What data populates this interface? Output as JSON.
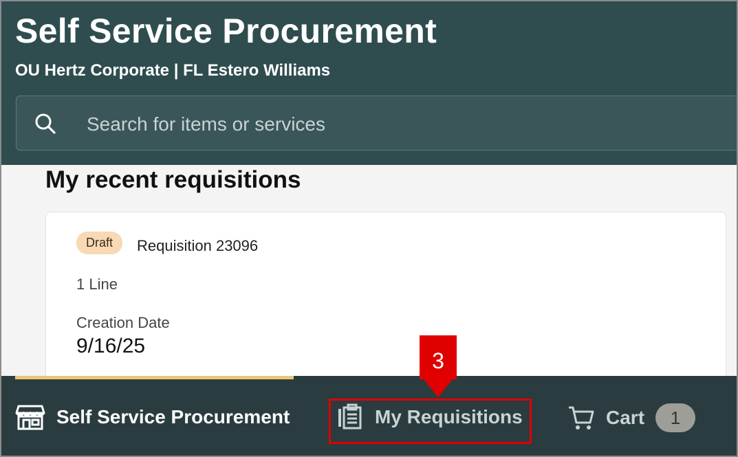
{
  "header": {
    "title": "Self Service Procurement",
    "subtitle": "OU Hertz Corporate | FL Estero Williams"
  },
  "search": {
    "placeholder": "Search for items or services",
    "icon": "search-icon"
  },
  "recent": {
    "title": "My recent requisitions",
    "card": {
      "status_badge": "Draft",
      "requisition": "Requisition 23096",
      "lines": "1 Line",
      "date_label": "Creation Date",
      "date_value": "9/16/25"
    }
  },
  "bottom_nav": {
    "items": [
      {
        "label": "Self Service Procurement",
        "icon": "store-icon",
        "active": true
      },
      {
        "label": "My Requisitions",
        "icon": "clipboard-icon",
        "active": false
      },
      {
        "label": "Cart",
        "icon": "cart-icon",
        "active": false,
        "badge": "1"
      }
    ]
  },
  "annotation": {
    "step_number": "3",
    "color": "#e00000"
  },
  "colors": {
    "header_bg": "#2f4d4f",
    "nav_bg": "#2a3c3f",
    "active_indicator": "#e8c774",
    "draft_badge": "#f8d9b5"
  }
}
